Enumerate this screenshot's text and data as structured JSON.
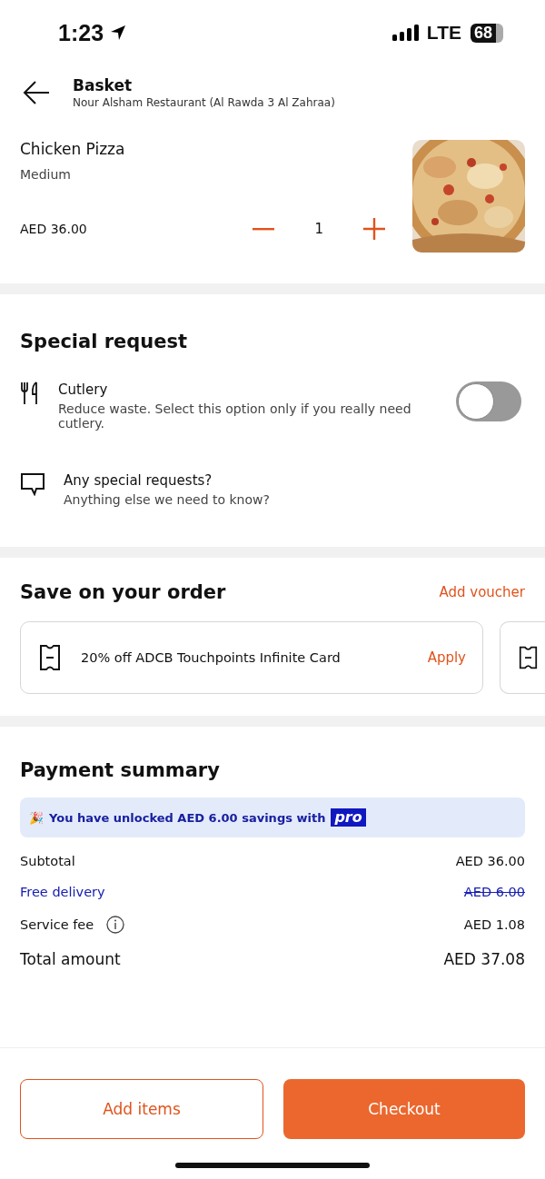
{
  "status_bar": {
    "time": "1:23",
    "network": "LTE",
    "battery": "68"
  },
  "header": {
    "title": "Basket",
    "subtitle": "Nour Alsham Restaurant (Al Rawda 3 Al Zahraa)"
  },
  "item": {
    "name": "Chicken Pizza",
    "size": "Medium",
    "price": "AED 36.00",
    "quantity": "1"
  },
  "special_request": {
    "title": "Special request",
    "options": [
      {
        "kind": "toggle",
        "title": "Cutlery",
        "description": "Reduce waste. Select this option only if you really need cutlery.",
        "on": false
      },
      {
        "kind": "note",
        "title": "Any special requests?",
        "description": "Anything else we need to know?"
      }
    ]
  },
  "savings": {
    "title": "Save on your order",
    "link": "Add voucher",
    "vouchers": [
      {
        "kind": "full",
        "text": "20% off ADCB Touchpoints Infinite Card",
        "action": "Apply"
      },
      {
        "kind": "cut"
      }
    ]
  },
  "payment": {
    "title": "Payment summary",
    "banner": {
      "emoji": "🎉",
      "text": "You have unlocked AED 6.00 savings with",
      "badge": "pro"
    },
    "rows": [
      {
        "kind": "plain",
        "label": "Subtotal",
        "value": "AED 36.00"
      },
      {
        "kind": "discount",
        "label": "Free delivery",
        "value": "AED 6.00"
      },
      {
        "kind": "info",
        "label": "Service fee",
        "value": "AED 1.08"
      },
      {
        "kind": "total",
        "label": "Total amount",
        "value": "AED 37.08"
      }
    ]
  },
  "buttons": {
    "secondary": "Add items",
    "primary": "Checkout"
  }
}
